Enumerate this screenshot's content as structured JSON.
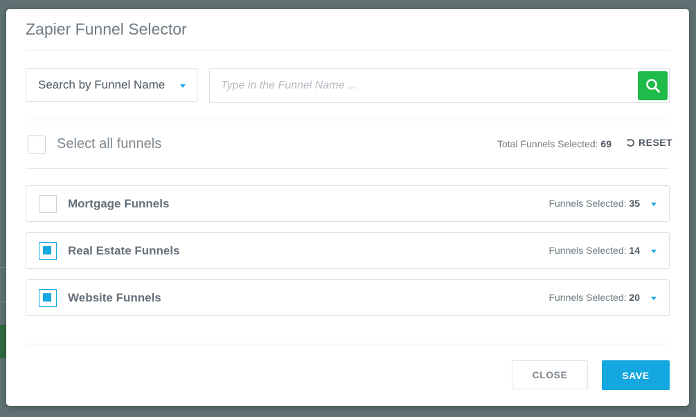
{
  "modal": {
    "title": "Zapier Funnel Selector"
  },
  "search": {
    "type_selected": "Search by Funnel Name",
    "placeholder": "Type in the Funnel Name ...",
    "value": ""
  },
  "selection": {
    "select_all_label": "Select all funnels",
    "total_label": "Total Funnels Selected:",
    "total_count": "69",
    "reset_label": "RESET"
  },
  "groups": [
    {
      "label": "Mortgage Funnels",
      "count_label": "Funnels Selected:",
      "count": "35",
      "checked": false
    },
    {
      "label": "Real Estate Funnels",
      "count_label": "Funnels Selected:",
      "count": "14",
      "checked": true
    },
    {
      "label": "Website Funnels",
      "count_label": "Funnels Selected:",
      "count": "20",
      "checked": true
    }
  ],
  "footer": {
    "close_label": "CLOSE",
    "save_label": "SAVE"
  },
  "colors": {
    "accent": "#15a7e0",
    "search_button": "#1fbb4a",
    "overlay": "#5f7173"
  },
  "icons": {
    "search": "search-icon",
    "reset": "undo-icon",
    "dropdown": "caret-down-icon"
  }
}
